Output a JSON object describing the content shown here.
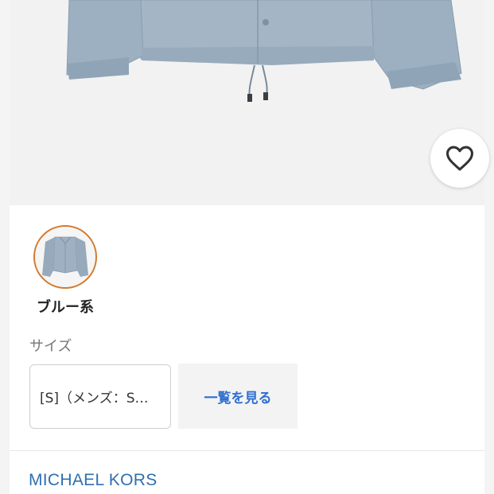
{
  "product": {
    "favorite_icon": "heart-outline-icon"
  },
  "color": {
    "label": "ブルー系",
    "swatch_color": "#9fb0c2",
    "ring_color": "#d47a2e"
  },
  "size": {
    "heading": "サイズ",
    "selected": "[S]（メンズ：S…",
    "list_button": "一覧を見る"
  },
  "brand": {
    "name": "MICHAEL KORS"
  },
  "colors": {
    "link": "#2f6fb0",
    "button_text": "#2f6fcf"
  }
}
